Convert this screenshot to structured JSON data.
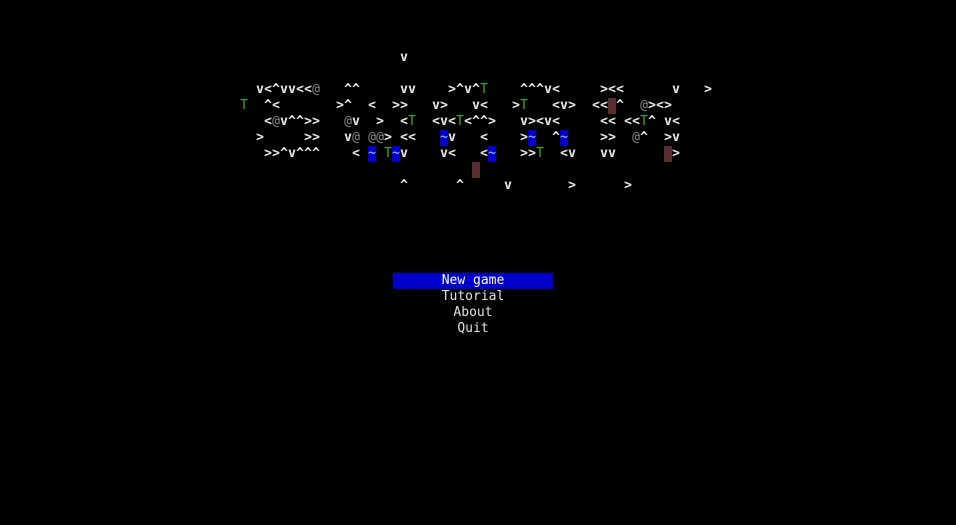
{
  "colors": {
    "background": "#000000",
    "text": "#e8e8e8",
    "tree": "#22bb22",
    "rock": "#8a8a8a",
    "water_bg": "#0000cc",
    "water_fg": "#9999ff",
    "wall": "#5a2e2e",
    "menu_highlight": "#0000cc"
  },
  "map_rows": [
    "                                                  v                                         ",
    "                                                                                            ",
    "                                v<^vv<<@   ^^     vv    >^v^T    ^^^v<     ><<      v   >   ",
    "                              T  ^<       >^  <  >>   v>   v<   >T   <v>  <<#^  @><>       ",
    "                                 <@v^^>>   @v  >  <T  <v<T<^^>   v><v<     << <<T^ v<       ",
    "                                >     >>   v@ @@> <<   ~v   <    >~  ^~    >>  @^  >v       ",
    "                                 >>^v^^^    < ~ T~v    v<   <~   >>T  <v   vv      #>       ",
    "                                                           #                                ",
    "                                                  ^      ^     v       >      >             "
  ],
  "menu": {
    "items": [
      "New game",
      "Tutorial",
      "About",
      "Quit"
    ],
    "selected_index": 0
  }
}
